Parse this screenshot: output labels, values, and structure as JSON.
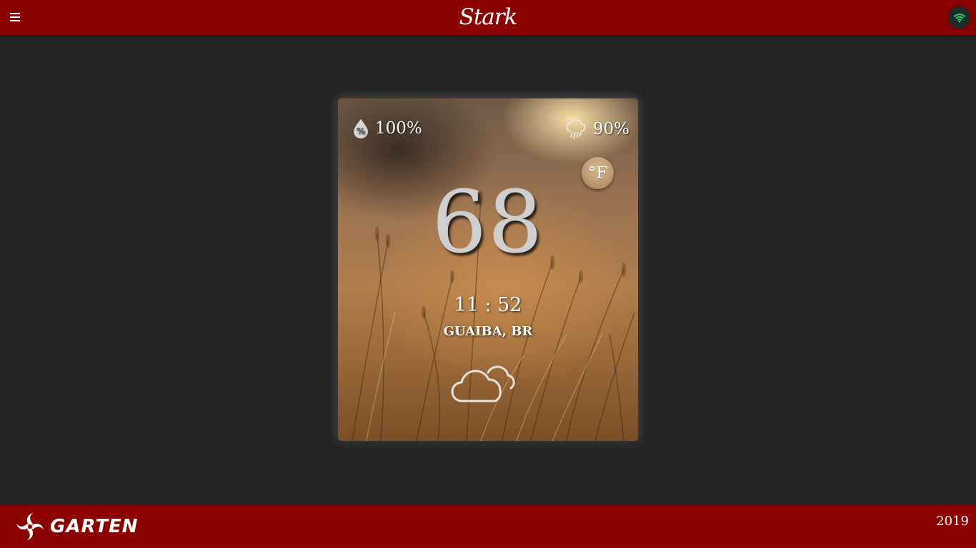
{
  "header": {
    "title": "Stark",
    "menu_icon": "hamburger-menu-icon",
    "wifi_icon": "wifi-icon",
    "wifi_color": "#2ecc71"
  },
  "weather": {
    "humidity": "100%",
    "humidity_icon": "humidity-drop-icon",
    "rain_chance": "90%",
    "rain_icon": "rain-cloud-icon",
    "unit": "°F",
    "temperature": "68",
    "time": "11 : 52",
    "location": "GUAIBA, BR",
    "condition_icon": "cloudy-icon"
  },
  "footer": {
    "brand": "GARTEN",
    "logo_icon": "spiral-logo-icon",
    "year": "2019"
  },
  "colors": {
    "brand_red": "#8b0000",
    "background": "#232323"
  }
}
